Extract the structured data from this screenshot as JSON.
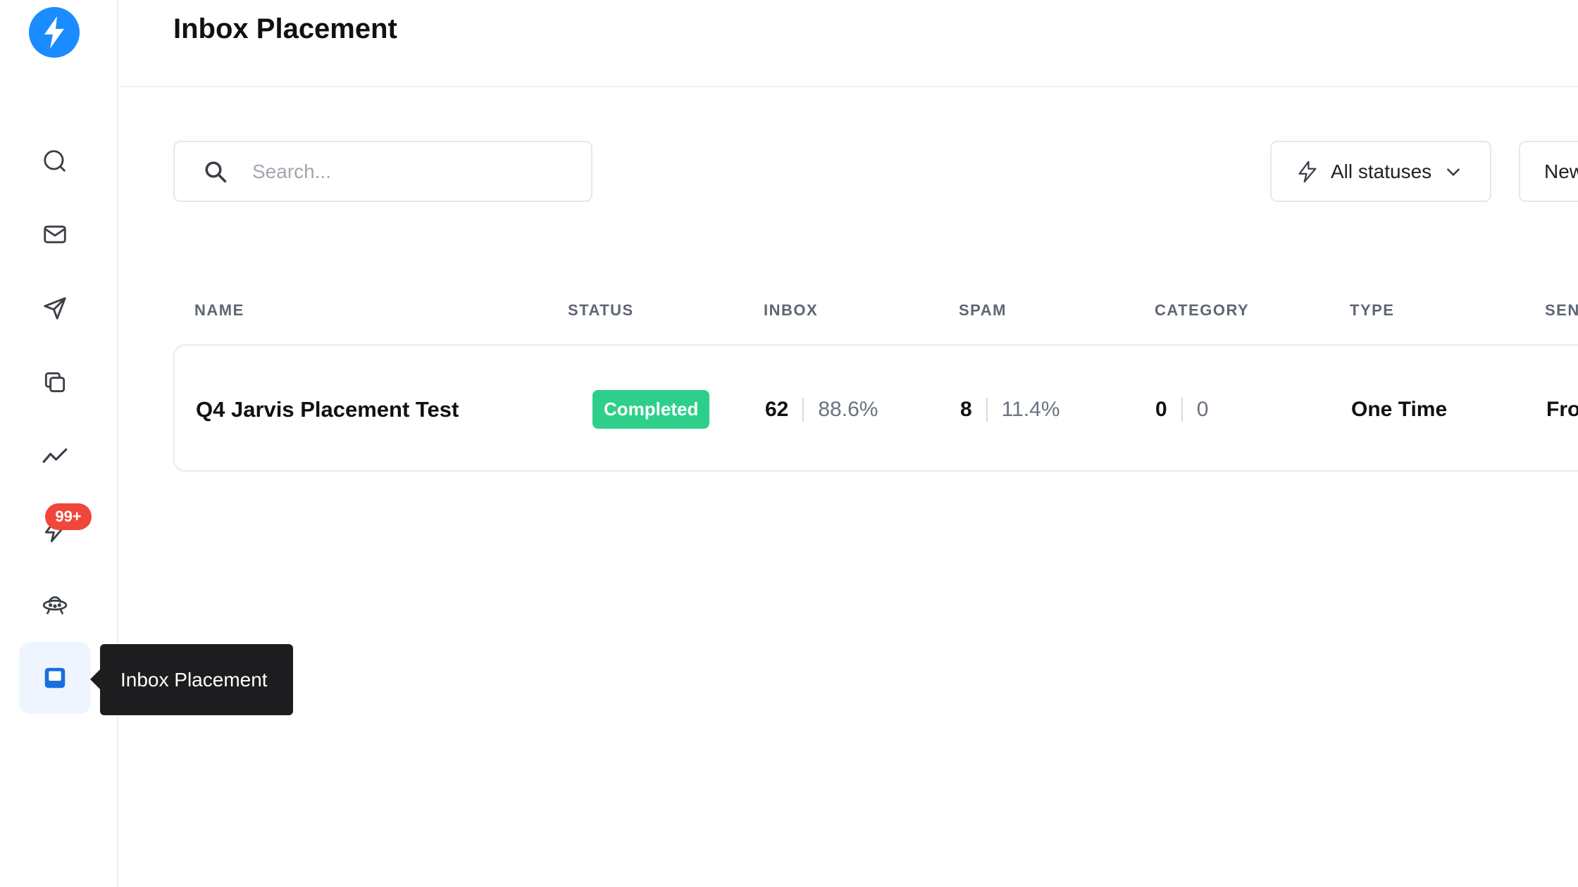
{
  "app": {
    "brand_color": "#1a8cff"
  },
  "header": {
    "title": "Inbox Placement"
  },
  "sidebar": {
    "items": [
      {
        "icon": "search-icon"
      },
      {
        "icon": "mail-icon"
      },
      {
        "icon": "send-icon"
      },
      {
        "icon": "copy-icon"
      },
      {
        "icon": "analytics-icon"
      },
      {
        "icon": "lightning-icon",
        "badge": "99+"
      },
      {
        "icon": "ufo-icon"
      },
      {
        "icon": "inbox-placement-icon",
        "active": true
      }
    ],
    "tooltip": "Inbox Placement"
  },
  "toolbar": {
    "search_placeholder": "Search...",
    "status_filter": "All statuses",
    "new_button": "New"
  },
  "table": {
    "columns": [
      "NAME",
      "STATUS",
      "INBOX",
      "SPAM",
      "CATEGORY",
      "TYPE",
      "SEN"
    ],
    "rows": [
      {
        "name": "Q4 Jarvis Placement Test",
        "status": "Completed",
        "inbox_count": "62",
        "inbox_pct": "88.6%",
        "spam_count": "8",
        "spam_pct": "11.4%",
        "category_a": "0",
        "category_b": "0",
        "type": "One Time",
        "sender": "Fro"
      }
    ]
  },
  "colors": {
    "status_completed": "#2ecf8a",
    "badge": "#f0463c",
    "active_bg": "#eef5ff"
  }
}
